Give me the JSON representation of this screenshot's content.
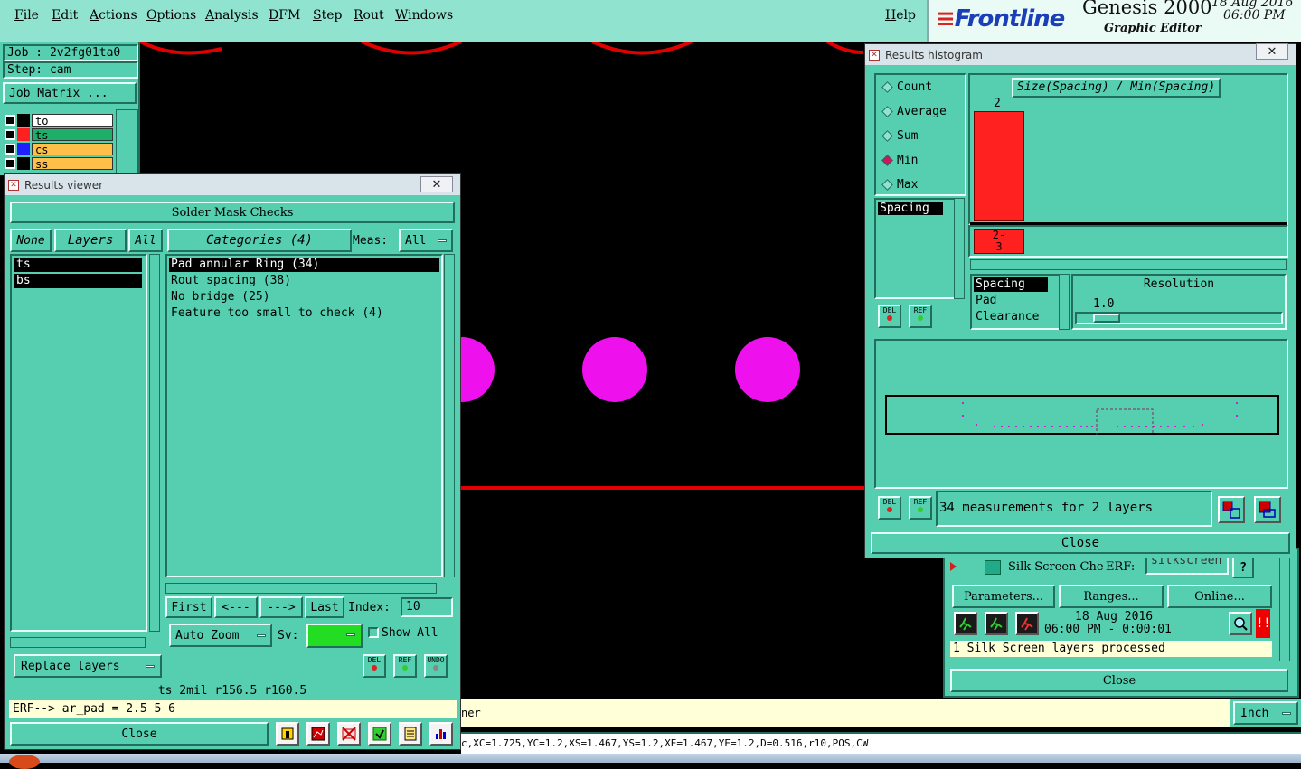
{
  "menu": {
    "items": [
      "File",
      "Edit",
      "Actions",
      "Options",
      "Analysis",
      "DFM",
      "Step",
      "Rout",
      "Windows"
    ],
    "help": "Help"
  },
  "brand": {
    "logo": "Frontline",
    "app": "Genesis 2000",
    "subtitle": "Graphic Editor",
    "date": "18 Aug 2016",
    "time": "06:00 PM"
  },
  "job_panel": {
    "job": "Job : 2v2fg01ta0",
    "step": "Step: cam",
    "matrix_button": "Job Matrix ...",
    "layers": [
      {
        "name": "to",
        "color": "#ffffff",
        "swatch": "#000000"
      },
      {
        "name": "ts",
        "color": "#1fae6a",
        "swatch": "#ff2020"
      },
      {
        "name": "cs",
        "color": "#ffc04a",
        "swatch": "#2020ff"
      },
      {
        "name": "ss",
        "color": "#ffc04a",
        "swatch": "#000000"
      }
    ]
  },
  "results_viewer": {
    "title": "Results viewer",
    "header": "Solder Mask Checks",
    "none_btn": "None",
    "layers_btn": "Layers",
    "all_btn": "All",
    "categories_btn": "Categories (4)",
    "meas_label": "Meas:",
    "meas_value": "All",
    "layer_list": [
      "ts",
      "bs"
    ],
    "categories": [
      "Pad annular Ring (34)",
      "Rout spacing (38)",
      "No bridge (25)",
      "Feature too small to check (4)"
    ],
    "nav": {
      "first": "First",
      "prev": "<---",
      "next": "--->",
      "last": "Last",
      "index_label": "Index:",
      "index_value": "10"
    },
    "auto_zoom": "Auto Zoom",
    "sv_label": "Sv:",
    "show_all": "Show All",
    "replace_layers": "Replace layers",
    "status": "ts 2mil  r156.5  r160.5",
    "erf": "ERF--> ar_pad = 2.5 5 6",
    "close": "Close",
    "del": "DEL",
    "ref": "REF",
    "undo": "UNDO"
  },
  "histogram": {
    "title": "Results histogram",
    "modes": [
      "Count",
      "Average",
      "Sum",
      "Min",
      "Max"
    ],
    "selected_mode": "Min",
    "chart_title": "Size(Spacing) / Min(Spacing)",
    "bar_value": "2",
    "bar_range": "2-3",
    "attribute_list": [
      "Spacing"
    ],
    "type_list": [
      "Spacing",
      "Pad",
      "Clearance"
    ],
    "resolution_label": "Resolution",
    "resolution_value": "1.0",
    "measurements": "34 measurements for 2 layers",
    "close": "Close",
    "del": "DEL",
    "ref": "REF"
  },
  "silk_panel": {
    "name": "Silk Screen Che",
    "erf_label": "ERF:",
    "erf_value": "silkscreen",
    "parameters": "Parameters...",
    "ranges": "Ranges...",
    "online": "Online...",
    "date": "18 Aug 2016",
    "time": "06:00 PM - 0:00:01",
    "status": "1 Silk Screen layers processed",
    "close": "Close"
  },
  "bottom": {
    "fragment": "ner",
    "units": "Inch",
    "coords": "c,XC=1.725,YC=1.2,XS=1.467,YS=1.2,XE=1.467,YE=1.2,D=0.516,r10,POS,CW"
  },
  "colors": {
    "panel": "#56cfb0",
    "pad": "#ee11ee",
    "trace": "#e00000",
    "histogram_bar": "#ff2020",
    "sv_swatch": "#22dd22"
  }
}
